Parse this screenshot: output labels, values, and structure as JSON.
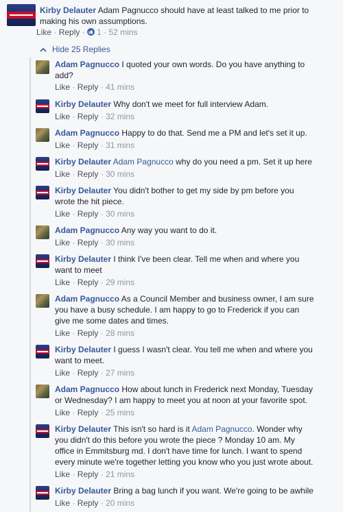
{
  "root": {
    "author": "Kirby Delauter",
    "body": " Adam Pagnucco should have at least talked to me prior to",
    "body2": "making his own assumptions.",
    "like": "Like",
    "reply": "Reply",
    "reactions": "1",
    "time": "52 mins"
  },
  "hide_replies": "Hide 25 Replies",
  "replies": [
    {
      "author": "Adam Pagnucco",
      "l1": " I quoted your own words. Do you have anything to",
      "l2": "add?",
      "like": "Like",
      "reply": "Reply",
      "time": "41 mins"
    },
    {
      "author": "Kirby Delauter",
      "l1": " Why don't we meet for full interview Adam.",
      "like": "Like",
      "reply": "Reply",
      "time": "32 mins"
    },
    {
      "author": "Adam Pagnucco",
      "l1": " Happy to do that. Send me a PM and let's set it up.",
      "like": "Like",
      "reply": "Reply",
      "time": "31 mins"
    },
    {
      "author": "Kirby Delauter",
      "mention": "Adam Pagnucco",
      "l1": " why do you need a pm. Set it up here",
      "like": "Like",
      "reply": "Reply",
      "time": "30 mins"
    },
    {
      "author": "Kirby Delauter",
      "l1": " You didn't bother to get my side by pm before you",
      "l2": "wrote the hit piece.",
      "like": "Like",
      "reply": "Reply",
      "time": "30 mins"
    },
    {
      "author": "Adam Pagnucco",
      "l1": " Any way you want to do it.",
      "like": "Like",
      "reply": "Reply",
      "time": "30 mins"
    },
    {
      "author": "Kirby Delauter",
      "l1": " I think I've been clear. Tell me when and where you",
      "l2": "want to meet",
      "like": "Like",
      "reply": "Reply",
      "time": "29 mins"
    },
    {
      "author": "Adam Pagnucco",
      "l1": " As a Council Member and business owner, I am sure",
      "l2": "you have a busy schedule. I am happy to go to Frederick if you can",
      "l3": "give me some dates and times.",
      "like": "Like",
      "reply": "Reply",
      "time": "28 mins"
    },
    {
      "author": "Kirby Delauter",
      "l1": " I guess I wasn't clear. You tell me when and where you",
      "l2": "want to meet.",
      "like": "Like",
      "reply": "Reply",
      "time": "27 mins"
    },
    {
      "author": "Adam Pagnucco",
      "l1": " How about lunch in Frederick next Monday, Tuesday",
      "l2": "or Wednesday? I am happy to meet you at noon at your favorite spot.",
      "like": "Like",
      "reply": "Reply",
      "time": "25 mins"
    },
    {
      "author": "Kirby Delauter",
      "l1": " This isn't so hard is it ",
      "mention_end": "Adam Pagnucco",
      "l1b": ". Wonder why",
      "l2": "you didn't do this before you wrote the piece ? Monday 10 am. My",
      "l3": "office in Emmitsburg md. I don't have time for lunch. I want to spend",
      "l4": "every minute we're together letting you know who you just wrote about.",
      "like": "Like",
      "reply": "Reply",
      "time": "21 mins"
    },
    {
      "author": "Kirby Delauter",
      "l1": " Bring a bag lunch if you want. We're going to be awhile",
      "like": "Like",
      "reply": "Reply",
      "time": "20 mins"
    }
  ]
}
